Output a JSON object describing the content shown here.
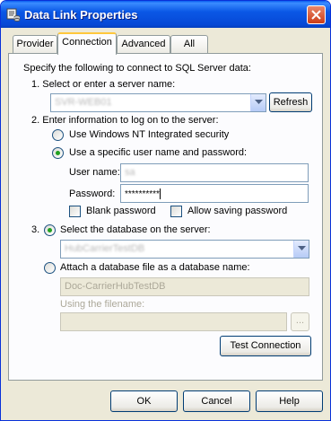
{
  "window": {
    "title": "Data Link Properties"
  },
  "tabs": [
    {
      "label": "Provider",
      "active": false
    },
    {
      "label": "Connection",
      "active": true
    },
    {
      "label": "Advanced",
      "active": false
    },
    {
      "label": "All",
      "active": false
    }
  ],
  "connection": {
    "intro": "Specify the following to connect to SQL Server data:",
    "step1_label": "1. Select or enter a server name:",
    "server_name": "SVR-WEB01",
    "refresh_label": "Refresh",
    "step2_label": "2. Enter information to log on to the server:",
    "nt_security_label": "Use Windows NT Integrated security",
    "specific_user_label": "Use a specific user name and password:",
    "username_label": "User name:",
    "username_value": "sa",
    "password_label": "Password:",
    "password_value": "**********",
    "blank_password_label": "Blank password",
    "allow_saving_label": "Allow saving password",
    "step3_number": "3.",
    "select_db_label": "Select the database on the server:",
    "database_value": "HubCarrierTestDB",
    "attach_db_label": "Attach a database file as a database name:",
    "attach_db_value": "Doc-CarrierHubTestDB",
    "filename_label": "Using the filename:",
    "browse_label": "...",
    "test_connection_label": "Test Connection"
  },
  "footer": {
    "ok_label": "OK",
    "cancel_label": "Cancel",
    "help_label": "Help"
  },
  "colors": {
    "titlebar": "#0b58e6",
    "dialog_bg": "#ece9d8",
    "tab_highlight": "#ffc83c",
    "close_button": "#cc3d17"
  }
}
